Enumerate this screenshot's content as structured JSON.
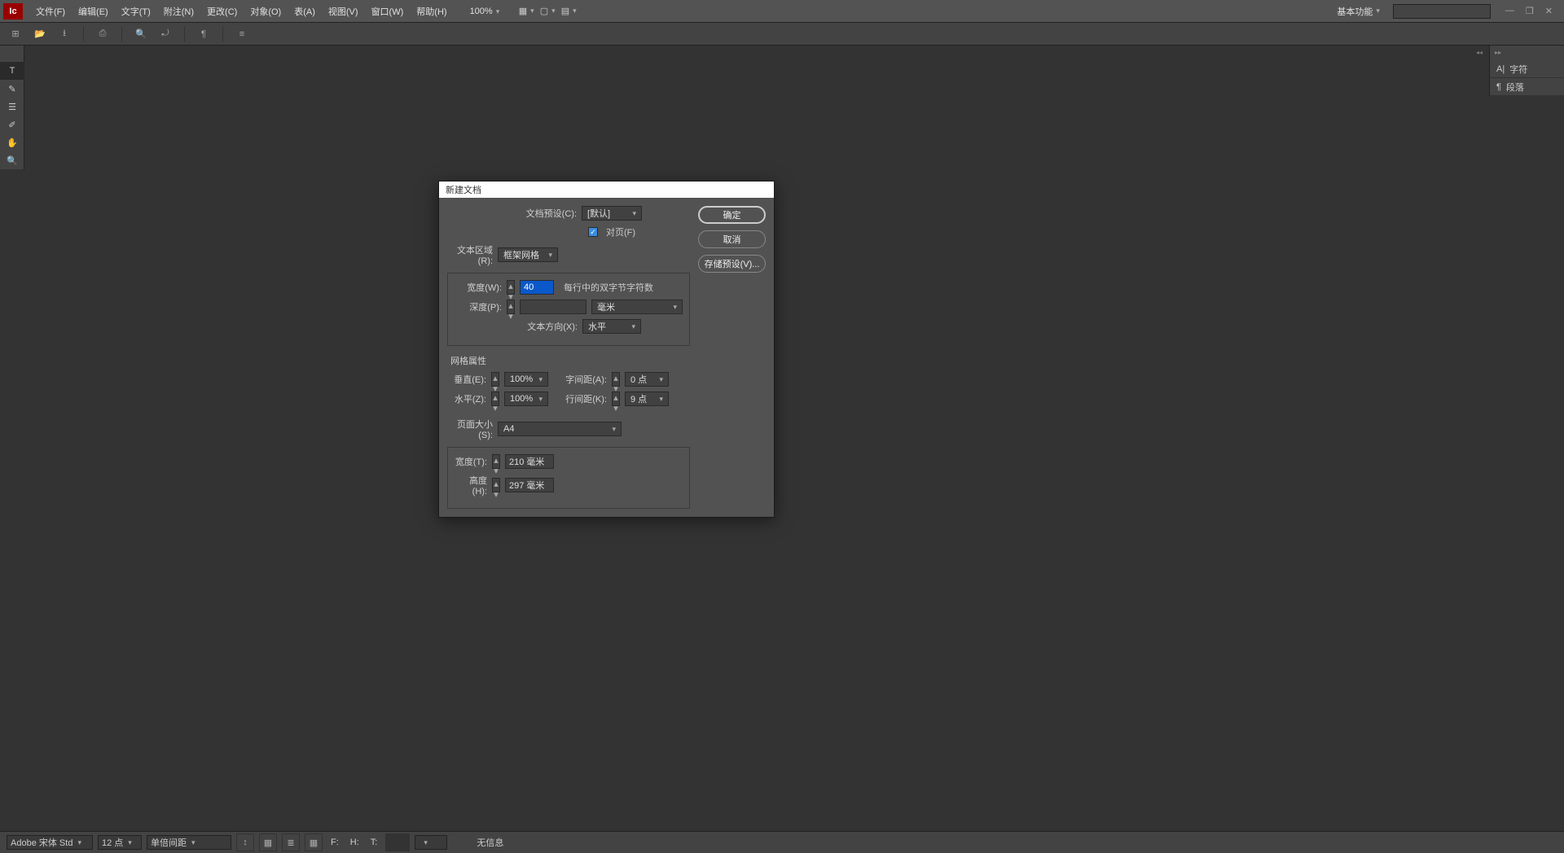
{
  "app": {
    "icon_text": "Ic"
  },
  "menu": {
    "file": "文件(F)",
    "edit": "编辑(E)",
    "text": "文字(T)",
    "annot": "附注(N)",
    "change": "更改(C)",
    "object": "对象(O)",
    "table": "表(A)",
    "view": "视图(V)",
    "window": "窗口(W)",
    "help": "帮助(H)"
  },
  "zoom": "100%",
  "workspace": "基本功能",
  "right_panels": {
    "char": "字符",
    "para": "段落"
  },
  "statusbar": {
    "font": "Adobe 宋体 Std",
    "font_size": "12 点",
    "line_spacing": "单倍间距",
    "f": "F:",
    "h": "H:",
    "t": "T:",
    "info": "无信息"
  },
  "dialog": {
    "title": "新建文档",
    "preset_label": "文档预设(C):",
    "preset_value": "[默认]",
    "facing_label": "对页(F)",
    "textarea_label": "文本区域(R):",
    "textarea_value": "框架网格",
    "width_label": "宽度(W):",
    "width_value": "40",
    "width_suffix": "每行中的双字节字符数",
    "depth_label": "深度(P):",
    "depth_unit": "毫米",
    "textdir_label": "文本方向(X):",
    "textdir_value": "水平",
    "grid_title": "网格属性",
    "vert_label": "垂直(E):",
    "vert_value": "100%",
    "horz_label": "水平(Z):",
    "horz_value": "100%",
    "charsp_label": "字间距(A):",
    "charsp_value": "0 点",
    "linesp_label": "行间距(K):",
    "linesp_value": "9 点",
    "pagesize_label": "页面大小(S):",
    "pagesize_value": "A4",
    "pwidth_label": "宽度(T):",
    "pwidth_value": "210 毫米",
    "pheight_label": "高度(H):",
    "pheight_value": "297 毫米",
    "ok": "确定",
    "cancel": "取消",
    "save_preset": "存储预设(V)..."
  }
}
